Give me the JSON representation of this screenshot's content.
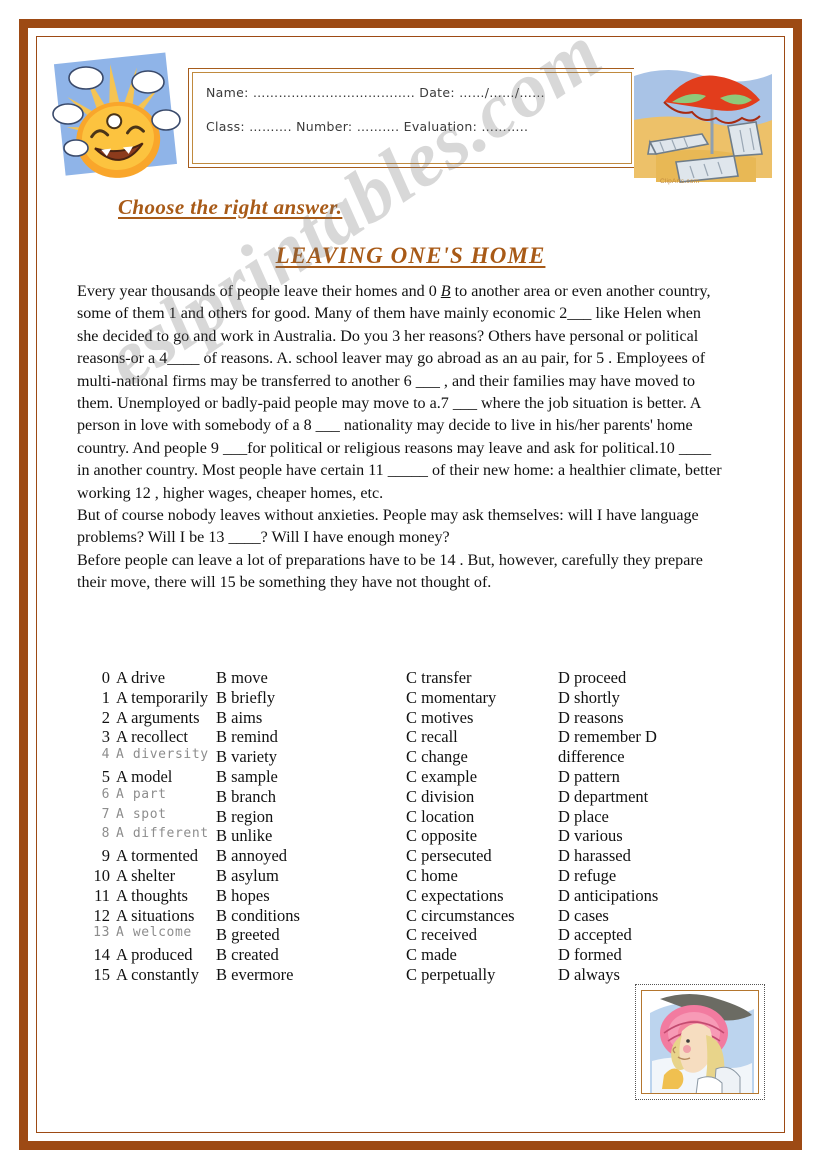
{
  "page": {
    "border_color": "#9d4a14",
    "accent_color": "#a85a17",
    "watermark": "eslprintables.com"
  },
  "student_info": {
    "line1": "Name: ……………………………….. Date: ……/……/……",
    "line2": "Class: ………. Number: ………. Evaluation: ……….."
  },
  "clipart": {
    "sun_alt": "smiling-sun-with-clouds",
    "beach_alt": "beach-umbrella-with-loungers",
    "beach_credit": "ClipArts.com",
    "lady_alt": "woman-in-pink-sun-hat"
  },
  "headings": {
    "instruction": "Choose the right answer.",
    "title": "LEAVING ONE'S HOME"
  },
  "passage": {
    "paragraph1_pre": "Every year thousands of people leave their homes and 0 ",
    "example_answer": "B",
    "paragraph1": " to another area or even another country, some of them 1      and others for good. Many of them have mainly economic 2___  like Helen when she decided to go and work in Australia. Do you 3       her reasons? Others have personal or political reasons-or a 4____   of reasons. A. school leaver may go abroad as an au pair, for 5      . Employees of multi-national firms may be transferred to another 6 ___ , and their families may have moved to them. Unemployed or badly-paid people may move to a.7 ___  where the job situation is better. A person in love with somebody of a 8 ___  nationality may decide to live in his/her parents' home country. And people 9  ___for political or religious reasons may leave and ask for political.10 ____  in another country. Most people have certain 11  _____ of their new home: a healthier climate, better working 12          , higher wages, cheaper homes, etc.",
    "paragraph2": "But of course nobody leaves without anxieties. People may ask themselves: will I have language problems? Will I be 13 ____? Will I have enough money?",
    "paragraph3": "Before people can leave a lot of preparations have to be 14       . But, however, carefully they prepare their move, there will 15    be something they have not thought of."
  },
  "answer_options": {
    "rows": [
      {
        "num": "0",
        "a": "A drive",
        "b": "B move",
        "c": "C transfer",
        "d": "D proceed",
        "faded": false
      },
      {
        "num": "1",
        "a": "A temporarily",
        "b": "B briefly",
        "c": "C momentary",
        "d": "D shortly",
        "faded": false
      },
      {
        "num": "2",
        "a": "A arguments",
        "b": "B aims",
        "c": "C motives",
        "d": "D reasons",
        "faded": false
      },
      {
        "num": "3",
        "a": "A recollect",
        "b": "B remind",
        "c": "C recall",
        "d": "D remember  D",
        "faded": false
      },
      {
        "num": "4",
        "a": "A diversity",
        "b": "B variety",
        "c": "C change",
        "d": "difference",
        "faded": true
      },
      {
        "num": "5",
        "a": "A model",
        "b": "B sample",
        "c": "C example",
        "d": "D pattern",
        "faded": false
      },
      {
        "num": "6",
        "a": "A part",
        "b": "B branch",
        "c": "C division",
        "d": "D department",
        "faded": true
      },
      {
        "num": "7",
        "a": "A spot",
        "b": "B region",
        "c": "C location",
        "d": "D place",
        "faded": true
      },
      {
        "num": "8",
        "a": "A different",
        "b": "B unlike",
        "c": "C opposite",
        "d": "D various",
        "faded": true
      },
      {
        "num": "9",
        "a": "A tormented",
        "b": "B annoyed",
        "c": "C persecuted",
        "d": "D harassed",
        "faded": false
      },
      {
        "num": "10",
        "a": "A shelter",
        "b": "B asylum",
        "c": "C home",
        "d": "D refuge",
        "faded": false
      },
      {
        "num": "11",
        "a": "A thoughts",
        "b": "B hopes",
        "c": "C expectations",
        "d": "D anticipations",
        "faded": false
      },
      {
        "num": "12",
        "a": "A situations",
        "b": "B conditions",
        "c": "C circumstances",
        "d": "D cases",
        "faded": false
      },
      {
        "num": "13",
        "a": "A welcome",
        "b": "B greeted",
        "c": "C received",
        "d": "D accepted",
        "faded": true
      },
      {
        "num": "14",
        "a": "A produced",
        "b": "B created",
        "c": "C made",
        "d": "D formed",
        "faded": false
      },
      {
        "num": "15",
        "a": "A constantly",
        "b": "B evermore",
        "c": "C perpetually",
        "d": "D always",
        "faded": false
      }
    ]
  }
}
